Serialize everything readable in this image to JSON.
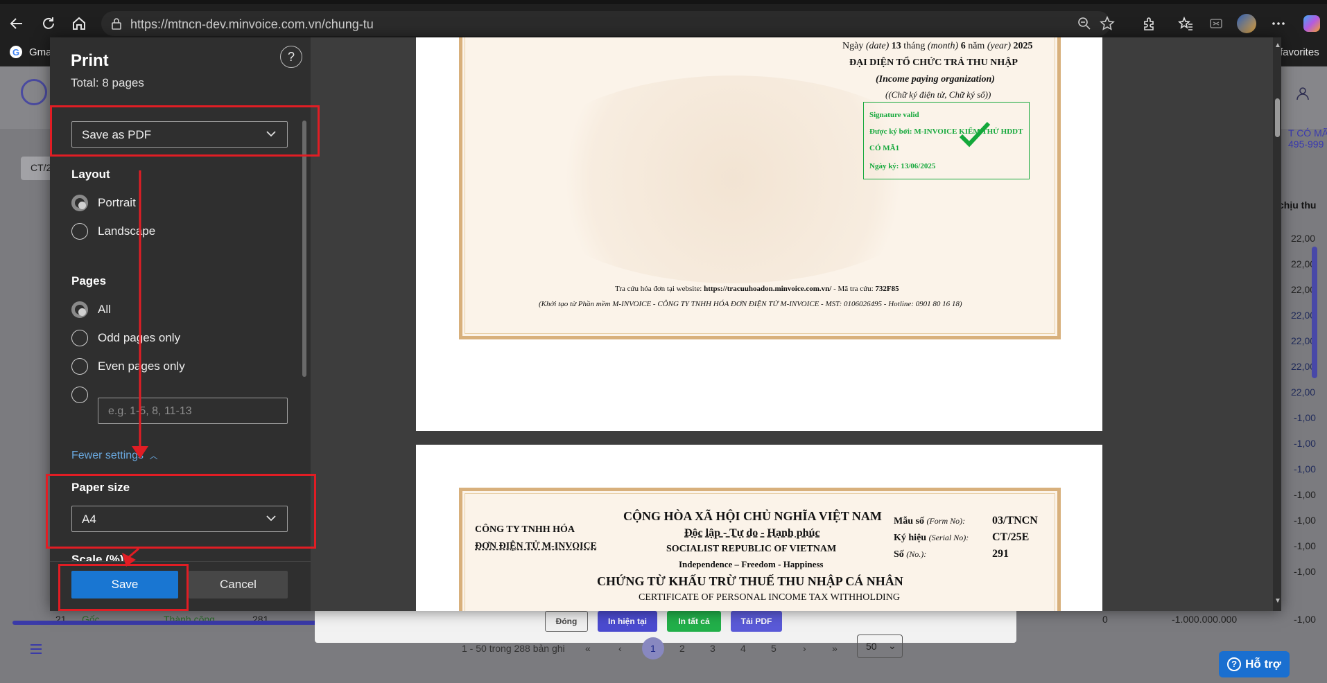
{
  "browser": {
    "url": "https://mtncn-dev.minvoice.com.vn/chung-tu",
    "favorites_label": "favorites",
    "gmail_label": "Gma"
  },
  "background_page": {
    "breadcrumb_right_1": "T CÓ MÃ",
    "breadcrumb_right_2": "495-999",
    "filter_label": "CT/2",
    "column_header_right": "chịu thu",
    "row_values_right": [
      "22,00",
      "22,00",
      "22,00",
      "22,00",
      "22,00",
      "22,00",
      "22,00",
      "-1,00",
      "-1,00",
      "-1,00",
      "-1,00",
      "-1,00",
      "-1,00",
      "-1,00"
    ],
    "last_row": {
      "no": "21",
      "type": "Gốc",
      "status": "Thành công",
      "number": "281",
      "amount_a": "0",
      "amount_b": "-1.000.000.000",
      "amount_c": "-1,00"
    },
    "pagination_text": "1 - 50 trong 288 bản ghi",
    "pages": [
      "1",
      "2",
      "3",
      "4",
      "5"
    ],
    "page_size": "50",
    "buttons": {
      "close": "Đóng",
      "print_current": "In hiện tại",
      "print_all": "In tất cả",
      "download_pdf": "Tải PDF"
    },
    "support": "Hỗ trợ"
  },
  "print_panel": {
    "title": "Print",
    "total": "Total: 8 pages",
    "destination": "Save as PDF",
    "layout_label": "Layout",
    "layout_options": [
      "Portrait",
      "Landscape"
    ],
    "layout_selected": "Portrait",
    "pages_label": "Pages",
    "pages_options": [
      "All",
      "Odd pages only",
      "Even pages only"
    ],
    "pages_selected": "All",
    "custom_pages_placeholder": "e.g. 1-5, 8, 11-13",
    "fewer_settings": "Fewer settings",
    "paper_size_label": "Paper size",
    "paper_size": "A4",
    "scale_label": "Scale (%)",
    "save": "Save",
    "cancel": "Cancel"
  },
  "preview": {
    "page1": {
      "date_line": {
        "prefix": "Ngày",
        "date_en": "(date)",
        "day": "13",
        "thang": "tháng",
        "month_en": "(month)",
        "month": "6",
        "nam": "năm",
        "year_en": "(year)",
        "year": "2025"
      },
      "org_vn": "ĐẠI DIỆN TỔ CHỨC TRẢ THU NHẬP",
      "org_en": "(Income paying organization)",
      "sign_note": "((Chữ ký điện tử, Chữ ký số))",
      "signature": {
        "valid": "Signature valid",
        "signed_by": "Được ký bởi: M-INVOICE KIỂM THỬ HDDT",
        "signed_by_2": "CÓ MÃ1",
        "signed_date": "Ngày ký: 13/06/2025"
      },
      "lookup_prefix": "Tra cứu hóa đơn tại website:",
      "lookup_url": "https://tracuuhoadon.minvoice.com.vn/",
      "lookup_code_label": "- Mã tra cứu:",
      "lookup_code": "732F85",
      "footer": "(Khởi tạo từ Phần mềm M-INVOICE - CÔNG TY TNHH HÓA ĐƠN ĐIỆN TỬ M-INVOICE - MST: 0106026495 - Hotline: 0901 80 16 18)"
    },
    "page2": {
      "company_1": "CÔNG TY TNHH HÓA",
      "company_2": "ĐƠN ĐIỆN TỬ M-INVOICE",
      "republic_vn": "CỘNG HÒA XÃ HỘI CHỦ NGHĨA VIỆT NAM",
      "motto_vn": "Độc lập - Tự do - Hạnh phúc",
      "republic_en": "SOCIALIST REPUBLIC OF VIETNAM",
      "motto_en": "Independence – Freedom - Happiness",
      "title_vn": "CHỨNG TỪ KHẤU TRỪ THUẾ THU NHẬP CÁ NHÂN",
      "title_en": "CERTIFICATE OF PERSONAL INCOME TAX WITHHOLDING",
      "form_no_label": "Mẫu số",
      "form_no_en": "(Form No):",
      "form_no": "03/TNCN",
      "serial_label": "Ký hiệu",
      "serial_en": "(Serial No):",
      "serial": "CT/25E",
      "no_label": "Số",
      "no_en": "(No.):",
      "no": "291"
    }
  }
}
